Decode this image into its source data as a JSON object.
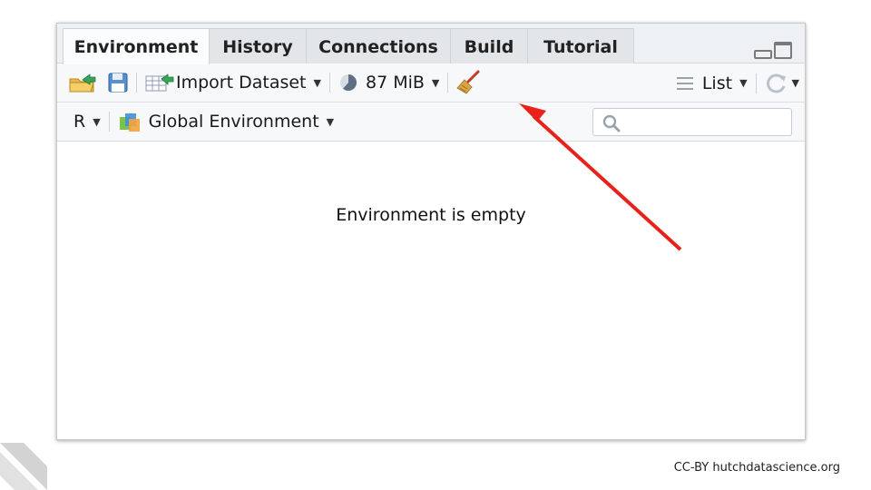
{
  "tabs": [
    {
      "label": "Environment",
      "active": true
    },
    {
      "label": "History",
      "active": false
    },
    {
      "label": "Connections",
      "active": false
    },
    {
      "label": "Build",
      "active": false
    },
    {
      "label": "Tutorial",
      "active": false
    }
  ],
  "toolbar": {
    "import_label": "Import Dataset",
    "memory_label": "87 MiB",
    "view_label": "List",
    "icons": [
      "open-folder-icon",
      "save-icon",
      "import-table-icon",
      "memory-pie-icon",
      "broom-icon",
      "list-icon",
      "refresh-icon"
    ]
  },
  "env_bar": {
    "language_label": "R",
    "scope_label": "Global Environment",
    "search_placeholder": ""
  },
  "main": {
    "empty_message": "Environment is empty"
  },
  "annotation": {
    "arrow_color": "#e8211b"
  },
  "footer": {
    "credit": "CC-BY hutchdatascience.org"
  }
}
